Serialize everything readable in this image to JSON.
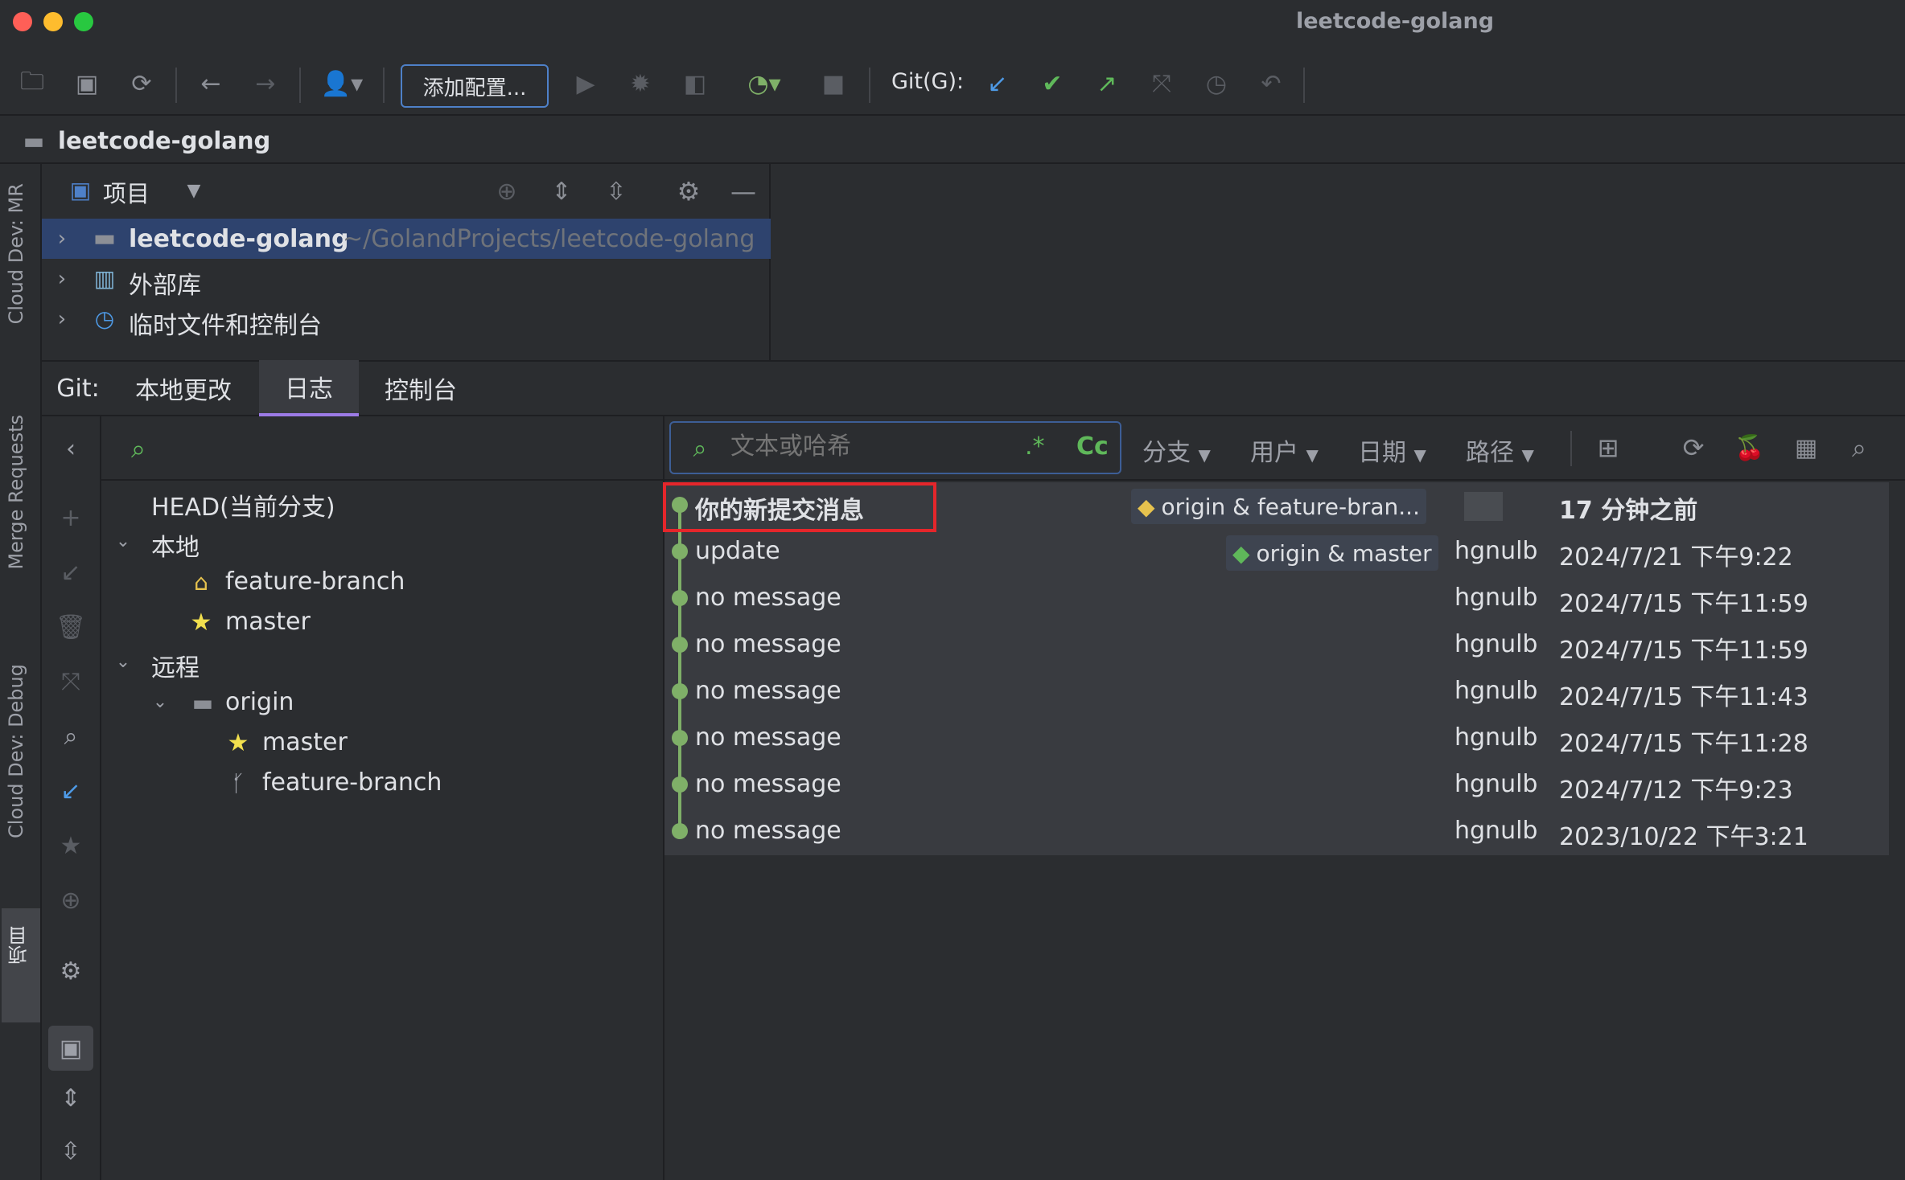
{
  "window": {
    "title": "leetcode-golang"
  },
  "toolbar": {
    "add_config_label": "添加配置...",
    "git_label": "Git(G):"
  },
  "breadcrumb": {
    "project": "leetcode-golang"
  },
  "left_stripe": {
    "tabs": [
      "Cloud Dev: MR",
      "Merge Requests",
      "Cloud Dev: Debug",
      "项目"
    ]
  },
  "project_panel": {
    "title": "项目",
    "tree": [
      {
        "label": "leetcode-golang",
        "path": "~/GolandProjects/leetcode-golang"
      },
      {
        "label": "外部库"
      },
      {
        "label": "临时文件和控制台"
      }
    ]
  },
  "git": {
    "prefix": "Git:",
    "tabs": [
      "本地更改",
      "日志",
      "控制台"
    ]
  },
  "branches": {
    "head": "HEAD(当前分支)",
    "local_label": "本地",
    "local": [
      "feature-branch",
      "master"
    ],
    "remote_label": "远程",
    "remote_group": "origin",
    "remote": [
      "master",
      "feature-branch"
    ]
  },
  "log": {
    "search_placeholder": "文本或哈希",
    "regex_label": ".*",
    "case_label": "Cc",
    "filters": [
      "分支",
      "用户",
      "日期",
      "路径"
    ],
    "commits": [
      {
        "message": "你的新提交消息",
        "ref": "origin & feature-bran...",
        "author": "",
        "date": "17 分钟之前",
        "bold": true
      },
      {
        "message": "update",
        "ref": "origin & master",
        "author": "hgnulb",
        "date": "2024/7/21 下午9:22"
      },
      {
        "message": "no message",
        "ref": "",
        "author": "hgnulb",
        "date": "2024/7/15 下午11:59"
      },
      {
        "message": "no message",
        "ref": "",
        "author": "hgnulb",
        "date": "2024/7/15 下午11:59"
      },
      {
        "message": "no message",
        "ref": "",
        "author": "hgnulb",
        "date": "2024/7/15 下午11:43"
      },
      {
        "message": "no message",
        "ref": "",
        "author": "hgnulb",
        "date": "2024/7/15 下午11:28"
      },
      {
        "message": "no message",
        "ref": "",
        "author": "hgnulb",
        "date": "2024/7/12 下午9:23"
      },
      {
        "message": "no message",
        "ref": "",
        "author": "hgnulb",
        "date": "2023/10/22 下午3:21"
      }
    ]
  },
  "colors": {
    "accent": "#4e80c8",
    "graph": "#7fb068",
    "highlight": "#e5262b",
    "selection": "#2e436e"
  }
}
